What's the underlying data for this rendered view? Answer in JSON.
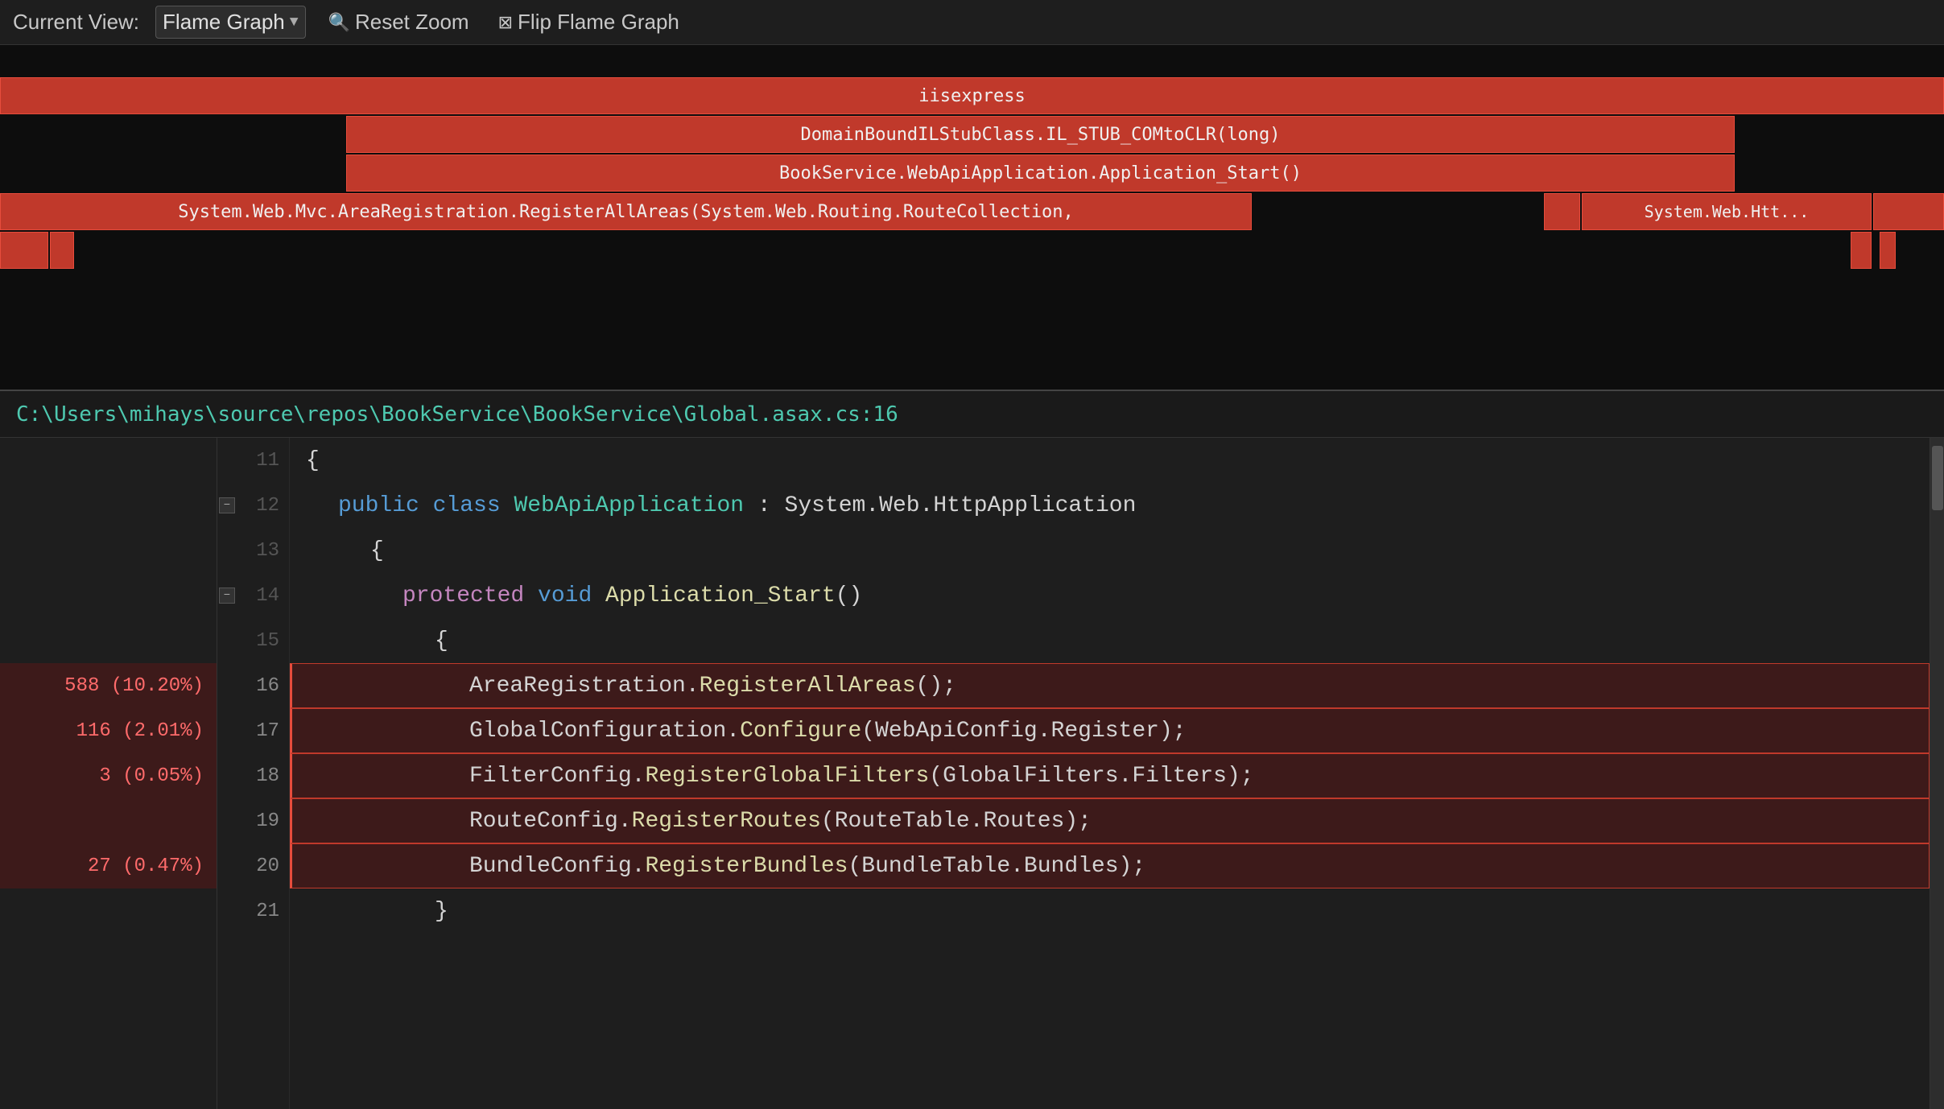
{
  "toolbar": {
    "current_view_label": "Current View:",
    "view_name": "Flame Graph",
    "reset_zoom_label": "Reset Zoom",
    "flip_label": "Flip Flame Graph"
  },
  "flame": {
    "bar1_text": "iisexpress",
    "bar2_text": "DomainBoundILStubClass.IL_STUB_COMtoCLR(long)",
    "bar3_text": "BookService.WebApiApplication.Application_Start()",
    "bar4_text": "System.Web.Mvc.AreaRegistration.RegisterAllAreas(System.Web.Routing.RouteCollection,",
    "bar4b_text": "System.Web.Htt...",
    "bar4c_text": ""
  },
  "filepath": {
    "text": "C:\\Users\\mihays\\source\\repos\\BookService\\BookService\\Global.asax.cs:16"
  },
  "code": {
    "lines": [
      {
        "num": 11,
        "gutter": "",
        "text": "{",
        "highlighted": false,
        "collapse": false,
        "indent": 0
      },
      {
        "num": 12,
        "gutter": "",
        "text": "public class WebApiApplication : System.Web.HttpApplication",
        "highlighted": false,
        "collapse": true,
        "indent": 1
      },
      {
        "num": 13,
        "gutter": "",
        "text": "{",
        "highlighted": false,
        "collapse": false,
        "indent": 1
      },
      {
        "num": 14,
        "gutter": "",
        "text": "protected void Application_Start()",
        "highlighted": false,
        "collapse": true,
        "indent": 2
      },
      {
        "num": 15,
        "gutter": "",
        "text": "{",
        "highlighted": false,
        "collapse": false,
        "indent": 2
      },
      {
        "num": 16,
        "gutter": "588 (10.20%)",
        "text": "AreaRegistration.RegisterAllAreas();",
        "highlighted": true,
        "collapse": false,
        "indent": 3
      },
      {
        "num": 17,
        "gutter": "116 (2.01%)",
        "text": "GlobalConfiguration.Configure(WebApiConfig.Register);",
        "highlighted": true,
        "collapse": false,
        "indent": 3
      },
      {
        "num": 18,
        "gutter": "3 (0.05%)",
        "text": "FilterConfig.RegisterGlobalFilters(GlobalFilters.Filters);",
        "highlighted": true,
        "collapse": false,
        "indent": 3
      },
      {
        "num": 19,
        "gutter": "",
        "text": "RouteConfig.RegisterRoutes(RouteTable.Routes);",
        "highlighted": true,
        "collapse": false,
        "indent": 3
      },
      {
        "num": 20,
        "gutter": "27 (0.47%)",
        "text": "BundleConfig.RegisterBundles(BundleTable.Bundles);",
        "highlighted": true,
        "collapse": false,
        "indent": 3
      },
      {
        "num": 21,
        "gutter": "",
        "text": "}",
        "highlighted": false,
        "collapse": false,
        "indent": 2
      }
    ]
  }
}
